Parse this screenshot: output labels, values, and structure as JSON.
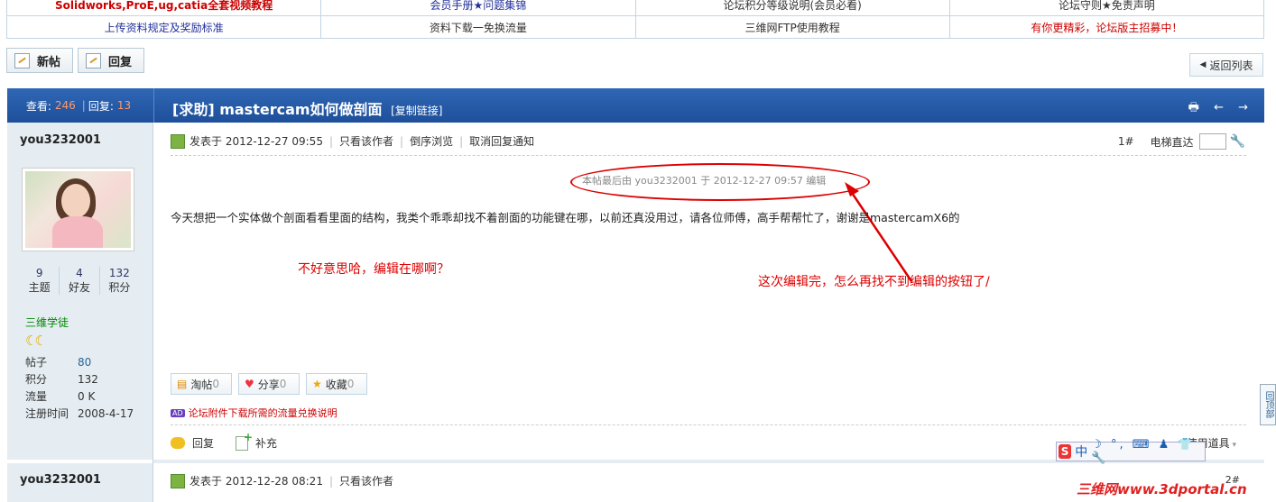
{
  "top_links": [
    [
      "Solidworks,ProE,ug,catia全套视频教程",
      "会员手册★问题集锦",
      "论坛积分等级说明(会员必看)",
      "论坛守则★免责声明"
    ],
    [
      "上传资料规定及奖励标准",
      "资料下载一免换流量",
      "三维网FTP使用教程",
      "有你更精彩，论坛版主招募中！"
    ]
  ],
  "buttons": {
    "new_post": "新帖",
    "reply": "回复",
    "back_to_list": "返回列表"
  },
  "thread": {
    "views_label": "查看:",
    "views": "246",
    "replies_label": "回复:",
    "replies": "13",
    "title": "[求助] mastercam如何做剖面",
    "copy_link": "[复制链接]",
    "tools": "🖶 ← →"
  },
  "author": {
    "name": "you3232001",
    "stats": [
      {
        "value": "9",
        "label": "主题"
      },
      {
        "value": "4",
        "label": "好友"
      },
      {
        "value": "132",
        "label": "积分"
      }
    ],
    "rank": "三维学徒",
    "rank_icons": "☾☾",
    "info": [
      {
        "k": "帖子",
        "v": "80"
      },
      {
        "k": "积分",
        "v": "132"
      },
      {
        "k": "流量",
        "v": "0 K"
      },
      {
        "k": "注册时间",
        "v": "2008-4-17"
      }
    ]
  },
  "post1": {
    "posted": "发表于 2012-12-27 09:55",
    "only_author": "只看该作者",
    "reverse": "倒序浏览",
    "cancel_notify": "取消回复通知",
    "floor": "1#",
    "elevator": "电梯直达",
    "edit_note": "本帖最后由 you3232001 于 2012-12-27 09:57 编辑",
    "content": "今天想把一个实体做个剖面看看里面的结构，我类个乖乖却找不着剖面的功能键在哪，以前还真没用过，请各位师傅，高手帮帮忙了，谢谢是mastercamX6的",
    "annotation_left": "不好意思哈，编辑在哪啊？",
    "annotation_right": "这次编辑完，怎么再找不到编辑的按钮了/",
    "pills": [
      {
        "label": "淘帖",
        "count": "0"
      },
      {
        "label": "分享",
        "count": "0"
      },
      {
        "label": "收藏",
        "count": "0"
      }
    ],
    "ad_tag": "AD",
    "ad_text": "论坛附件下载所需的流量兑换说明",
    "reply": "回复",
    "supplement": "补充",
    "use_tool": "使用道具"
  },
  "post2": {
    "author": "you3232001",
    "posted": "发表于 2012-12-28 08:21",
    "only_author": "只看该作者",
    "floor": "2#"
  },
  "back_top": "回顶部",
  "ime": {
    "logo": "S",
    "text": "中",
    "glyphs": "☽ °, ⌨ ♟ 👕 🔧"
  },
  "watermark": "三维网www.3dportal.cn"
}
